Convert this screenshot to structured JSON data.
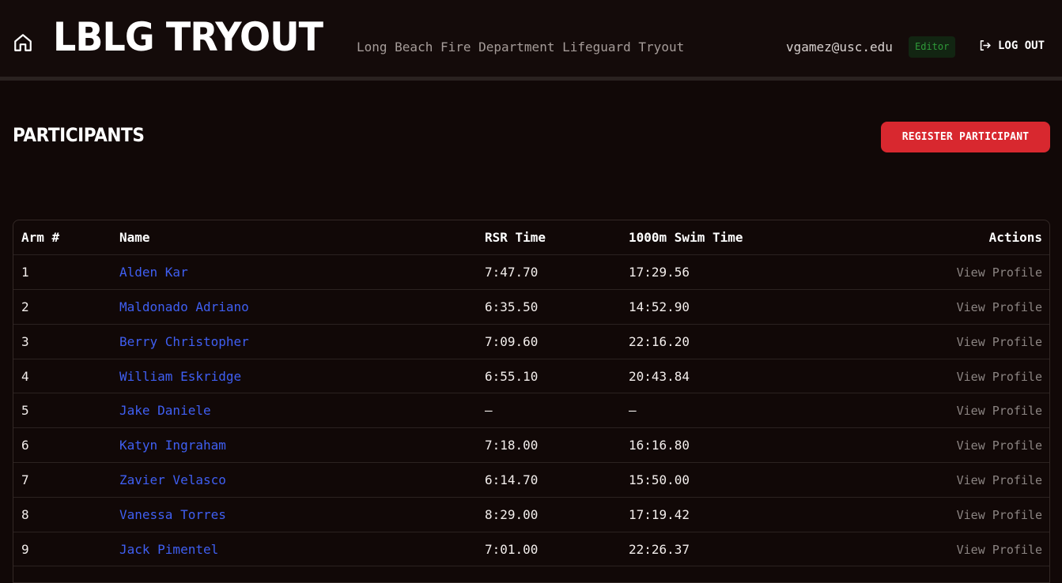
{
  "header": {
    "brand": "LBLG TRYOUT",
    "subtitle": "Long Beach Fire Department Lifeguard Tryout",
    "user_email": "vgamez@usc.edu",
    "role_badge": "Editor",
    "logout_label": "LOG OUT",
    "home_icon": "home-icon",
    "logout_icon": "logout-icon"
  },
  "page": {
    "title": "PARTICIPANTS",
    "register_label": "REGISTER PARTICIPANT"
  },
  "table": {
    "headers": {
      "arm": "Arm #",
      "name": "Name",
      "rsr": "RSR Time",
      "swim": "1000m Swim Time",
      "actions": "Actions"
    },
    "rows": [
      {
        "arm": "1",
        "name": "Alden Kar",
        "rsr": "7:47.70",
        "swim": "17:29.56",
        "action": "View Profile"
      },
      {
        "arm": "2",
        "name": "Maldonado Adriano",
        "rsr": "6:35.50",
        "swim": "14:52.90",
        "action": "View Profile"
      },
      {
        "arm": "3",
        "name": "Berry Christopher",
        "rsr": "7:09.60",
        "swim": "22:16.20",
        "action": "View Profile"
      },
      {
        "arm": "4",
        "name": "William Eskridge",
        "rsr": "6:55.10",
        "swim": "20:43.84",
        "action": "View Profile"
      },
      {
        "arm": "5",
        "name": "Jake Daniele",
        "rsr": "—",
        "swim": "—",
        "action": "View Profile"
      },
      {
        "arm": "6",
        "name": "Katyn Ingraham",
        "rsr": "7:18.00",
        "swim": "16:16.80",
        "action": "View Profile"
      },
      {
        "arm": "7",
        "name": "Zavier Velasco",
        "rsr": "6:14.70",
        "swim": "15:50.00",
        "action": "View Profile"
      },
      {
        "arm": "8",
        "name": "Vanessa Torres",
        "rsr": "8:29.00",
        "swim": "17:19.42",
        "action": "View Profile"
      },
      {
        "arm": "9",
        "name": "Jack Pimentel",
        "rsr": "7:01.00",
        "swim": "22:26.37",
        "action": "View Profile"
      }
    ]
  },
  "colors": {
    "background": "#110807",
    "accent_red": "#d8282f",
    "link_blue": "#3f5ff2",
    "badge_green": "#2f9a39"
  }
}
